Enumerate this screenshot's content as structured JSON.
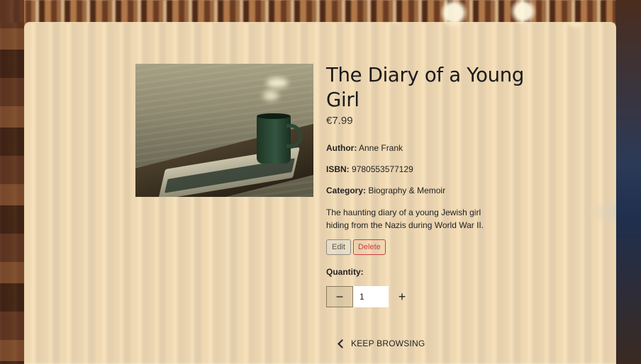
{
  "product": {
    "title": "The Diary of a Young Girl",
    "price": "€7.99",
    "author_label": "Author:",
    "author": "Anne Frank",
    "isbn_label": "ISBN:",
    "isbn": "9780553577129",
    "category_label": "Category:",
    "category": "Biography & Memoir",
    "description": "The haunting diary of a young Jewish girl hiding from the Nazis during World War II."
  },
  "actions": {
    "edit_label": "Edit",
    "delete_label": "Delete"
  },
  "quantity": {
    "label": "Quantity:",
    "value": "1",
    "decrement": "−",
    "increment": "+"
  },
  "nav": {
    "keep_browsing_label": "KEEP BROWSING"
  },
  "colors": {
    "card_bg": "#fdecc8",
    "delete_red": "#d23a3a"
  }
}
